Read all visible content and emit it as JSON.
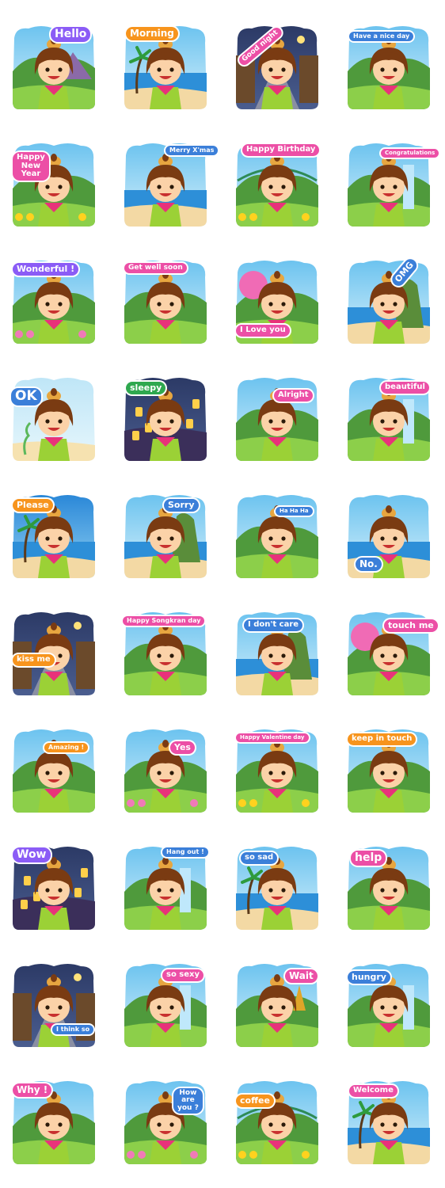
{
  "stickers": [
    {
      "label": "Hello",
      "scene": "mountain"
    },
    {
      "label": "Morning",
      "scene": "beach"
    },
    {
      "label": "Good night",
      "scene": "night"
    },
    {
      "label": "Have a nice day",
      "scene": "road"
    },
    {
      "label": "Happy\nNew\nYear",
      "scene": "flowers"
    },
    {
      "label": "Merry X'mas",
      "scene": "sea"
    },
    {
      "label": "Happy  Birthday",
      "scene": "bridge"
    },
    {
      "label": "Congratulations",
      "scene": "waterfall"
    },
    {
      "label": "Wonderful !",
      "scene": "lotus"
    },
    {
      "label": "Get well soon",
      "scene": "boat"
    },
    {
      "label": "I Love you",
      "scene": "blossom"
    },
    {
      "label": "OMG",
      "scene": "cliff"
    },
    {
      "label": "OK",
      "scene": "underwater"
    },
    {
      "label": "sleepy",
      "scene": "lanterns"
    },
    {
      "label": "Alright",
      "scene": "camp"
    },
    {
      "label": "beautiful",
      "scene": "waterfall"
    },
    {
      "label": "Please",
      "scene": "sunset"
    },
    {
      "label": "Sorry",
      "scene": "cliff"
    },
    {
      "label": "Ha Ha Ha",
      "scene": "field"
    },
    {
      "label": "No.",
      "scene": "sea"
    },
    {
      "label": "kiss me",
      "scene": "nightstreet"
    },
    {
      "label": "Happy Songkran day",
      "scene": "forest"
    },
    {
      "label": "I don't care",
      "scene": "cliff"
    },
    {
      "label": "touch me",
      "scene": "blossom"
    },
    {
      "label": "Amazing !",
      "scene": "lake"
    },
    {
      "label": "Yes",
      "scene": "lotus"
    },
    {
      "label": "Happy Valentine day",
      "scene": "flowers"
    },
    {
      "label": "keep in touch",
      "scene": "boat"
    },
    {
      "label": "Wow",
      "scene": "lanterns"
    },
    {
      "label": "Hang out !",
      "scene": "waterfall"
    },
    {
      "label": "so sad",
      "scene": "beach"
    },
    {
      "label": "help",
      "scene": "field"
    },
    {
      "label": "I think so",
      "scene": "nightstreet"
    },
    {
      "label": "so sexy",
      "scene": "waterfall"
    },
    {
      "label": "Wait",
      "scene": "temple"
    },
    {
      "label": "hungry",
      "scene": "dam"
    },
    {
      "label": "Why !",
      "scene": "boat"
    },
    {
      "label": "How\nare\nyou ?",
      "scene": "lotus"
    },
    {
      "label": "coffee",
      "scene": "bridge"
    },
    {
      "label": "Welcome",
      "scene": "beach"
    }
  ],
  "colors": {
    "purple": "#8b5cf6",
    "pink": "#ec4fa6",
    "orange": "#f7941d",
    "blue": "#3b7fd9",
    "green": "#2fa84f",
    "skin": "#fbd2a8",
    "hair": "#7a3b12",
    "shirt": "#9bd136",
    "scarf": "#e8327a"
  }
}
